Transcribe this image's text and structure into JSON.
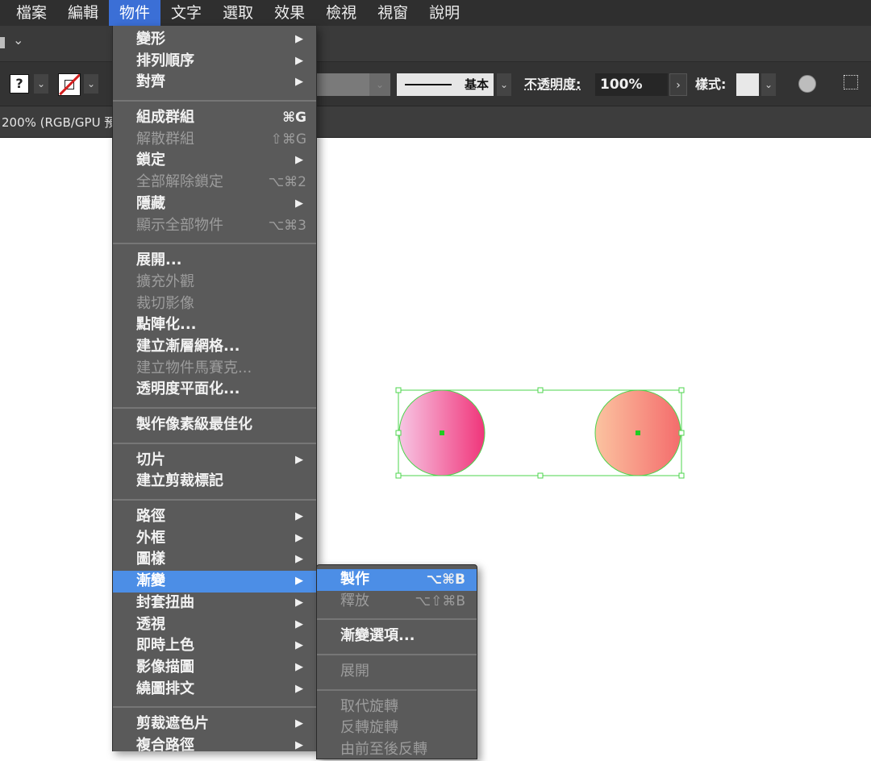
{
  "menubar": {
    "items": [
      "檔案",
      "編輯",
      "物件",
      "文字",
      "選取",
      "效果",
      "檢視",
      "視窗",
      "說明"
    ],
    "active_index": 2
  },
  "control_bar": {
    "fill_label": "?",
    "stroke_profile_label": "基本",
    "opacity_label": "不透明度:",
    "opacity_value": "100%",
    "style_label": "樣式:"
  },
  "document_tab": {
    "title": "200% (RGB/GPU 預"
  },
  "object_menu": {
    "sections": [
      [
        {
          "label": "變形",
          "submenu": true
        },
        {
          "label": "排列順序",
          "submenu": true
        },
        {
          "label": "對齊",
          "submenu": true
        }
      ],
      [
        {
          "label": "組成群組",
          "shortcut": "⌘G"
        },
        {
          "label": "解散群組",
          "shortcut": "⇧⌘G",
          "disabled": true
        },
        {
          "label": "鎖定",
          "submenu": true
        },
        {
          "label": "全部解除鎖定",
          "shortcut": "⌥⌘2",
          "disabled": true
        },
        {
          "label": "隱藏",
          "submenu": true
        },
        {
          "label": "顯示全部物件",
          "shortcut": "⌥⌘3",
          "disabled": true
        }
      ],
      [
        {
          "label": "展開..."
        },
        {
          "label": "擴充外觀",
          "disabled": true
        },
        {
          "label": "裁切影像",
          "disabled": true
        },
        {
          "label": "點陣化..."
        },
        {
          "label": "建立漸層網格..."
        },
        {
          "label": "建立物件馬賽克...",
          "disabled": true
        },
        {
          "label": "透明度平面化..."
        }
      ],
      [
        {
          "label": "製作像素級最佳化"
        }
      ],
      [
        {
          "label": "切片",
          "submenu": true
        },
        {
          "label": "建立剪裁標記"
        }
      ],
      [
        {
          "label": "路徑",
          "submenu": true
        },
        {
          "label": "外框",
          "submenu": true
        },
        {
          "label": "圖樣",
          "submenu": true
        },
        {
          "label": "漸變",
          "submenu": true,
          "highlighted": true
        },
        {
          "label": "封套扭曲",
          "submenu": true
        },
        {
          "label": "透視",
          "submenu": true
        },
        {
          "label": "即時上色",
          "submenu": true
        },
        {
          "label": "影像描圖",
          "submenu": true
        },
        {
          "label": "繞圖排文",
          "submenu": true
        }
      ],
      [
        {
          "label": "剪裁遮色片",
          "submenu": true
        },
        {
          "label": "複合路徑",
          "submenu": true
        }
      ]
    ]
  },
  "blend_submenu": {
    "sections": [
      [
        {
          "label": "製作",
          "shortcut": "⌥⌘B",
          "highlighted": true
        },
        {
          "label": "釋放",
          "shortcut": "⌥⇧⌘B",
          "disabled": true
        }
      ],
      [
        {
          "label": "漸變選項..."
        }
      ],
      [
        {
          "label": "展開",
          "disabled": true
        }
      ],
      [
        {
          "label": "取代旋轉",
          "disabled": true
        },
        {
          "label": "反轉旋轉",
          "disabled": true
        },
        {
          "label": "由前至後反轉",
          "disabled": true
        }
      ]
    ]
  },
  "colors": {
    "menubar_bg": "#2f2f2f",
    "menu_bg": "#5a5a5a",
    "highlight": "#4c8ee6",
    "selection_green": "#4cd44c",
    "circle1_light": "#f7c6e4",
    "circle1_dark": "#f0357a",
    "circle2_light": "#fbc3a0",
    "circle2_dark": "#f46c6c"
  },
  "icons": {
    "submenu_arrow": "arrow-right-icon",
    "dropdown": "chevron-down-icon",
    "no_stroke": "stroke-none-icon",
    "recolor": "recolor-wheel-icon"
  }
}
